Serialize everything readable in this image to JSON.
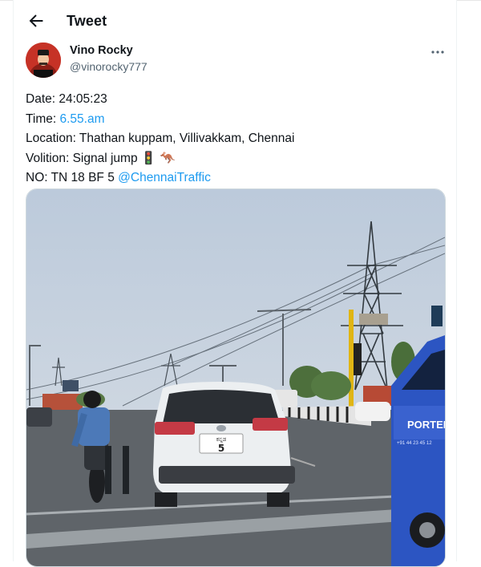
{
  "header": {
    "title": "Tweet"
  },
  "author": {
    "name": "Vino Rocky",
    "handle": "@vinorocky777"
  },
  "tweet": {
    "date_line": "Date: 24:05:23",
    "time_label": "Time: ",
    "time_value": "6.55.am",
    "location_line": "Location: Thathan kuppam, Villivakkam, Chennai",
    "volition_line": "Volition: Signal jump ",
    "volition_emoji": "🚦 🦘",
    "no_label": "NO: TN 18 BF 5 ",
    "mention": "@ChennaiTraffic"
  },
  "media": {
    "plate_top": "ಕನ್ನಡ",
    "plate_number": "5",
    "van_text": "PORTER",
    "van_phone": "+91 44 23 45 12"
  },
  "colors": {
    "link": "#1d9bf0",
    "secondary_text": "#536471",
    "border": "#cfd9de"
  },
  "icons": {
    "back": "arrow-left-icon",
    "more": "more-horizontal-icon"
  }
}
